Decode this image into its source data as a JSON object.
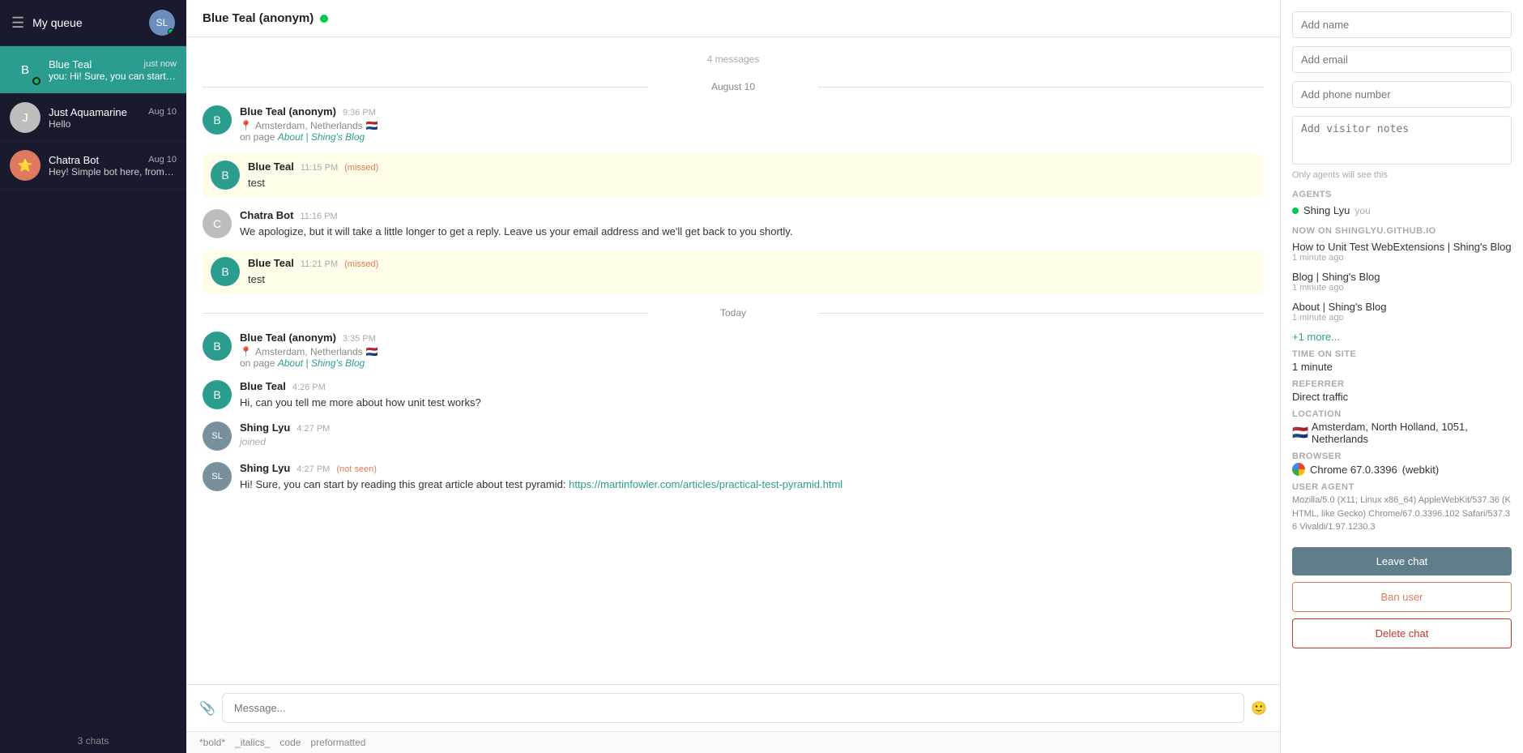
{
  "sidebar": {
    "title": "My queue",
    "chats_label": "3 chats",
    "items": [
      {
        "id": "blue-teal",
        "name": "Blue Teal",
        "time": "just now",
        "preview": "you: Hi! Sure, you can start by read...",
        "online": true,
        "active": true,
        "avatar_color": "#2a9d8f",
        "avatar_initial": "B"
      },
      {
        "id": "just-aquamarine",
        "name": "Just Aquamarine",
        "time": "Aug 10",
        "preview": "Hello",
        "online": false,
        "active": false,
        "avatar_color": "#bdbdbd",
        "avatar_initial": "J"
      },
      {
        "id": "chatra-bot",
        "name": "Chatra Bot",
        "time": "Aug 10",
        "preview": "Hey! Simple bot here, from Chatra...",
        "online": false,
        "active": false,
        "avatar_color": "#e07a5f",
        "avatar_initial": "C",
        "is_bot": true
      }
    ]
  },
  "chat": {
    "title": "Blue Teal (anonym)",
    "online": true,
    "msg_count": "4 messages",
    "sections": [
      {
        "type": "date_divider",
        "label": "August 10"
      },
      {
        "type": "visitor_arrival",
        "sender": "Blue Teal (anonym)",
        "time": "9:36 PM",
        "location": "Amsterdam, Netherlands",
        "flag": "🇳🇱",
        "page_text": "About | Shing's Blog",
        "page_url": "#"
      },
      {
        "type": "message",
        "sender": "Blue Teal",
        "time": "11:15 PM",
        "status": "missed",
        "text": "test",
        "highlight": true,
        "avatar_color": "#2a9d8f",
        "avatar_initial": "B"
      },
      {
        "type": "message",
        "sender": "Chatra Bot",
        "time": "11:16 PM",
        "status": null,
        "text": "We apologize, but it will take a little longer to get a reply. Leave us your email address and we'll get back to you shortly.",
        "highlight": false,
        "avatar_color": "#bdbdbd",
        "avatar_initial": "C"
      },
      {
        "type": "message",
        "sender": "Blue Teal",
        "time": "11:21 PM",
        "status": "missed",
        "text": "test",
        "highlight": true,
        "avatar_color": "#2a9d8f",
        "avatar_initial": "B"
      },
      {
        "type": "date_divider",
        "label": "Today"
      },
      {
        "type": "visitor_arrival",
        "sender": "Blue Teal (anonym)",
        "time": "3:35 PM",
        "location": "Amsterdam, Netherlands",
        "flag": "🇳🇱",
        "page_text": "About | Shing's Blog",
        "page_url": "#"
      },
      {
        "type": "message",
        "sender": "Blue Teal",
        "time": "4:26 PM",
        "status": null,
        "text": "Hi, can you tell me more about how unit test works?",
        "highlight": false,
        "avatar_color": "#2a9d8f",
        "avatar_initial": "B"
      },
      {
        "type": "joined",
        "sender": "Shing Lyu",
        "time": "4:27 PM",
        "text": "joined",
        "avatar_url": "agent"
      },
      {
        "type": "message",
        "sender": "Shing Lyu",
        "time": "4:27 PM",
        "status": "not seen",
        "text": "Hi! Sure, you can start by reading this great article about test pyramid: ",
        "link_text": "https://martinfowler.com/articles/practical-test-pyramid.html",
        "link_url": "https://martinfowler.com/articles/practical-test-pyramid.html",
        "highlight": false,
        "avatar_url": "agent"
      }
    ],
    "input_placeholder": "Message..."
  },
  "right_panel": {
    "add_name_placeholder": "Add name",
    "add_email_placeholder": "Add email",
    "add_phone_placeholder": "Add phone number",
    "add_notes_placeholder": "Add visitor notes",
    "only_agents_note": "Only agents will see this",
    "agents_label": "AGENTS",
    "agent_name": "Shing Lyu",
    "agent_you": "you",
    "now_on_label": "NOW ON SHINGLYU.GITHUB.IO",
    "pages": [
      {
        "title": "How to Unit Test WebExtensions | Shing's Blog",
        "time": "1 minute ago"
      },
      {
        "title": "Blog | Shing's Blog",
        "time": "1 minute ago"
      },
      {
        "title": "About | Shing's Blog",
        "time": "1 minute ago"
      }
    ],
    "more_link": "+1 more...",
    "time_on_site_label": "TIME ON SITE",
    "time_on_site": "1 minute",
    "referrer_label": "REFERRER",
    "referrer": "Direct traffic",
    "location_label": "LOCATION",
    "location": "Amsterdam, North Holland, 1051, Netherlands",
    "location_flag": "🇳🇱",
    "browser_label": "BROWSER",
    "browser": "Chrome 67.0.3396",
    "browser_extra": "(webkit)",
    "ua_label": "USER AGENT",
    "ua": "Mozilla/5.0 (X11; Linux x86_64) AppleWebKit/537.36 (KHTML, like Gecko) Chrome/67.0.3396.102 Safari/537.36 Vivaldi/1.97.1230.3",
    "leave_btn": "Leave chat",
    "ban_btn": "Ban user",
    "delete_btn": "Delete chat"
  },
  "format_bar": {
    "bold": "*bold*",
    "italic": "_italics_",
    "code": "code",
    "preformatted": "preformatted"
  }
}
